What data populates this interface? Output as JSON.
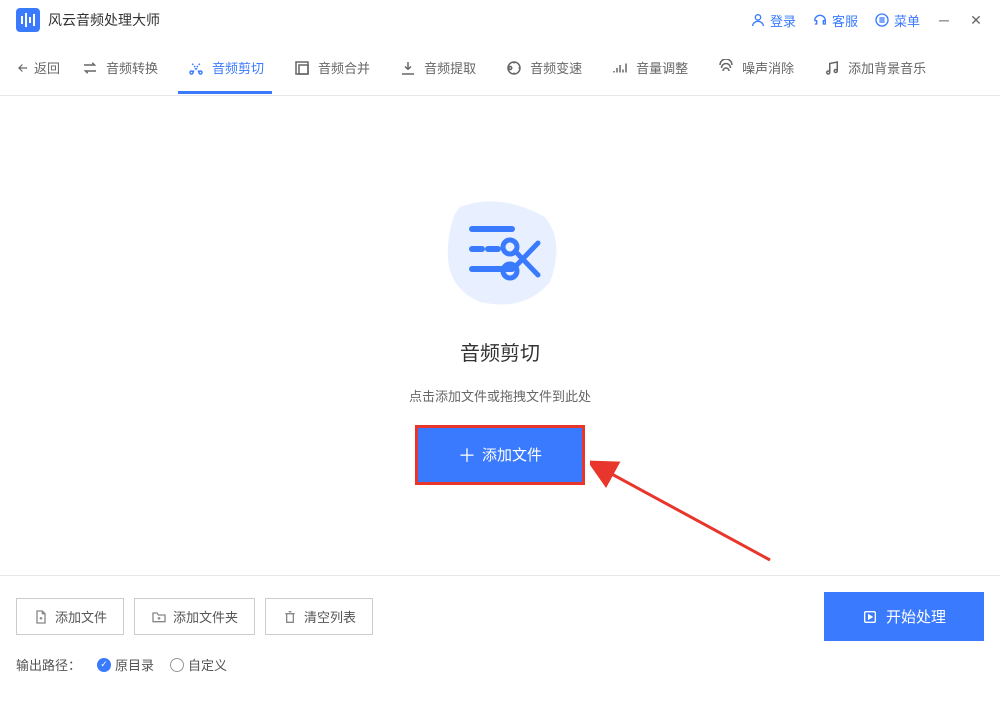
{
  "app": {
    "title": "风云音频处理大师"
  },
  "titlebar": {
    "login": "登录",
    "service": "客服",
    "menu": "菜单"
  },
  "toolbar": {
    "back": "返回",
    "tabs": [
      {
        "label": "音频转换"
      },
      {
        "label": "音频剪切"
      },
      {
        "label": "音频合并"
      },
      {
        "label": "音频提取"
      },
      {
        "label": "音频变速"
      },
      {
        "label": "音量调整"
      },
      {
        "label": "噪声消除"
      },
      {
        "label": "添加背景音乐"
      }
    ]
  },
  "hero": {
    "title": "音频剪切",
    "subtitle": "点击添加文件或拖拽文件到此处",
    "add_file": "添加文件"
  },
  "bottom": {
    "add_file": "添加文件",
    "add_folder": "添加文件夹",
    "clear_list": "清空列表",
    "start": "开始处理",
    "output_path_label": "输出路径：",
    "original_dir": "原目录",
    "custom": "自定义"
  }
}
